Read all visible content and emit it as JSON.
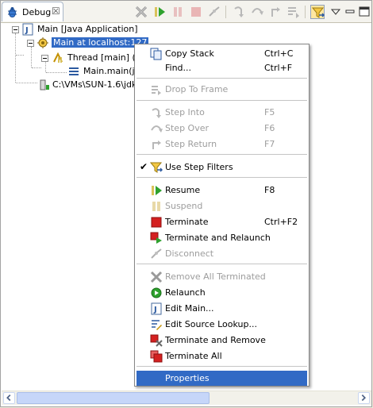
{
  "view": {
    "tab_title": "Debug",
    "tab_close": "☒"
  },
  "toolbar": [
    {
      "name": "remove-all-terminated-icon"
    },
    {
      "name": "resume-icon"
    },
    {
      "name": "suspend-icon"
    },
    {
      "name": "terminate-icon"
    },
    {
      "name": "disconnect-icon"
    },
    {
      "name": "step-into-icon"
    },
    {
      "name": "step-over-icon"
    },
    {
      "name": "step-return-icon"
    },
    {
      "name": "drop-to-frame-icon"
    },
    {
      "name": "use-step-filters-icon"
    },
    {
      "name": "view-menu-icon"
    },
    {
      "name": "minimize-icon"
    },
    {
      "name": "maximize-icon"
    }
  ],
  "tree": {
    "launch": "Main [Java Application]",
    "target": "Main at localhost:127",
    "thread": "Thread [main] (Su",
    "frame": "Main.main(jav",
    "process": "C:\\VMs\\SUN-1.6\\jdk6"
  },
  "menu": {
    "items": [
      {
        "label": "Copy Stack",
        "shortcut": "Ctrl+C",
        "icon": "copy-stack-icon",
        "enabled": true
      },
      {
        "label": "Find...",
        "shortcut": "Ctrl+F",
        "icon": "",
        "enabled": true
      },
      {
        "label": "Drop To Frame",
        "shortcut": "",
        "icon": "drop-to-frame-icon",
        "enabled": false
      },
      {
        "label": "Step Into",
        "shortcut": "F5",
        "icon": "step-into-icon",
        "enabled": false
      },
      {
        "label": "Step Over",
        "shortcut": "F6",
        "icon": "step-over-icon",
        "enabled": false
      },
      {
        "label": "Step Return",
        "shortcut": "F7",
        "icon": "step-return-icon",
        "enabled": false
      },
      {
        "label": "Use Step Filters",
        "shortcut": "",
        "icon": "use-step-filters-icon",
        "enabled": true,
        "checked": true
      },
      {
        "label": "Resume",
        "shortcut": "F8",
        "icon": "resume-icon",
        "enabled": true
      },
      {
        "label": "Suspend",
        "shortcut": "",
        "icon": "suspend-icon",
        "enabled": false
      },
      {
        "label": "Terminate",
        "shortcut": "Ctrl+F2",
        "icon": "terminate-icon",
        "enabled": true
      },
      {
        "label": "Terminate and Relaunch",
        "shortcut": "",
        "icon": "terminate-relaunch-icon",
        "enabled": true
      },
      {
        "label": "Disconnect",
        "shortcut": "",
        "icon": "disconnect-icon",
        "enabled": false
      },
      {
        "label": "Remove All Terminated",
        "shortcut": "",
        "icon": "remove-all-terminated-icon",
        "enabled": false
      },
      {
        "label": "Relaunch",
        "shortcut": "",
        "icon": "relaunch-icon",
        "enabled": true
      },
      {
        "label": "Edit Main...",
        "shortcut": "",
        "icon": "edit-launch-icon",
        "enabled": true
      },
      {
        "label": "Edit Source Lookup...",
        "shortcut": "",
        "icon": "edit-source-lookup-icon",
        "enabled": true
      },
      {
        "label": "Terminate and Remove",
        "shortcut": "",
        "icon": "terminate-remove-icon",
        "enabled": true
      },
      {
        "label": "Terminate All",
        "shortcut": "",
        "icon": "terminate-all-icon",
        "enabled": true
      },
      {
        "label": "Properties",
        "shortcut": "",
        "icon": "",
        "enabled": true,
        "selected": true
      }
    ]
  },
  "colors": {
    "selection": "#316ac5",
    "disabled_text": "#9d9d9d",
    "terminate_red": "#d42020",
    "resume_green": "#2ea12e"
  }
}
